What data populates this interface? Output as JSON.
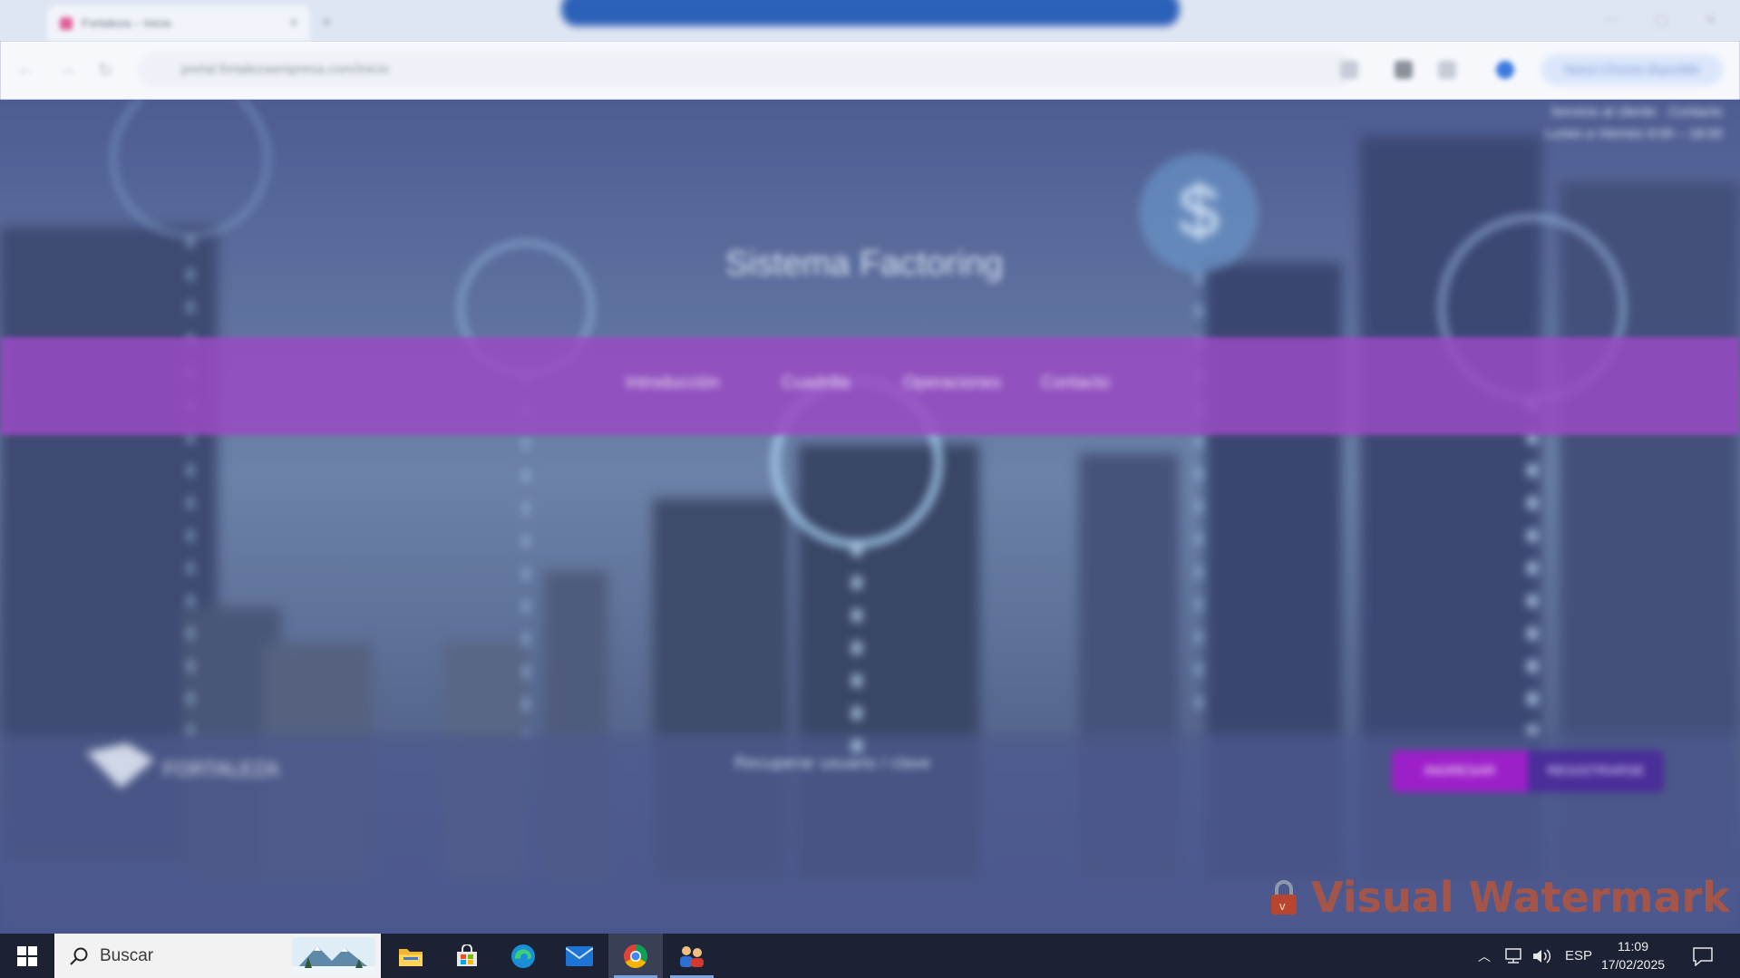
{
  "browser": {
    "tab_title": "Fortaleza – Inicio",
    "address": "portal.fortalezaempresa.com/Inicio",
    "profile_label": "Nuevo Chrome disponible",
    "notice_pill": ""
  },
  "page": {
    "headline": "Sistema Factoring",
    "top_right_info": [
      "Servicio al cliente  ·  Contacto",
      "Lunes a Viernes 9:00 – 18:00"
    ],
    "menu": [
      "Introducción",
      "Cuadrilla",
      "Operaciones",
      "Contacto"
    ],
    "logo_text": "FORTALEZA",
    "footer_note": "Recuperar usuario / clave",
    "cta_primary": "INGRESAR",
    "cta_secondary": "REGISTRARSE"
  },
  "watermark": {
    "text": "Visual Watermark",
    "icon": "padlock-icon"
  },
  "taskbar": {
    "search_placeholder": "Buscar",
    "apps": [
      {
        "name": "file-explorer",
        "icon": "folder-icon"
      },
      {
        "name": "microsoft-store",
        "icon": "store-icon"
      },
      {
        "name": "edge",
        "icon": "edge-icon"
      },
      {
        "name": "mail",
        "icon": "mail-icon"
      },
      {
        "name": "chrome",
        "icon": "chrome-icon",
        "active": true
      },
      {
        "name": "people-app",
        "icon": "people-icon"
      }
    ],
    "language": "ESP",
    "time": "11:09",
    "date": "17/02/2025"
  },
  "colors": {
    "menu_band": "#9a4ac4",
    "cta_primary": "#9d1fc9",
    "cta_secondary": "#4a2e99",
    "watermark": "#b4553f",
    "taskbar": "#1c2233"
  }
}
